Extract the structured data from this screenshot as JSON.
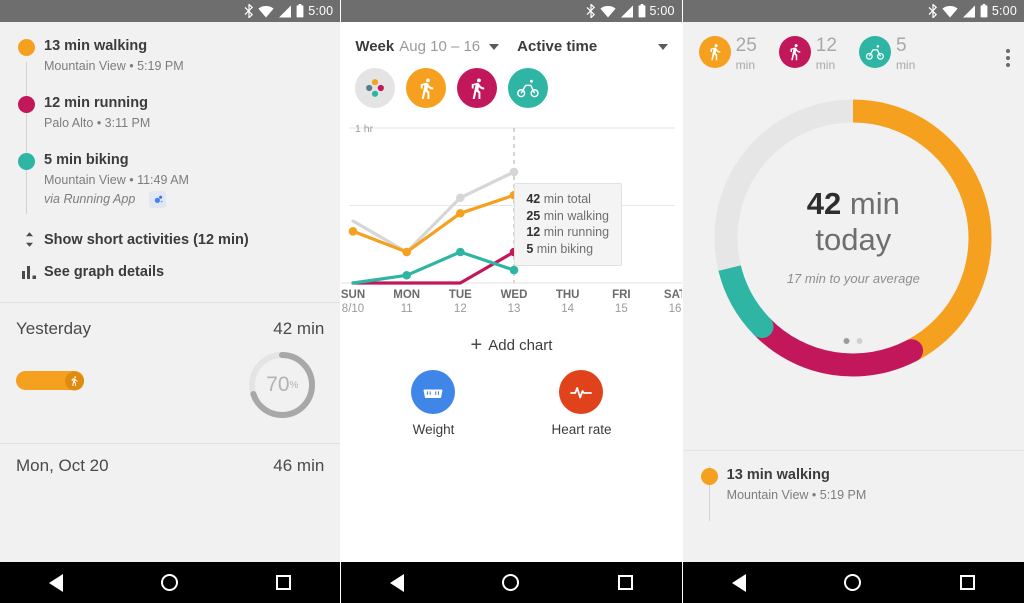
{
  "status_bar": {
    "time": "5:00",
    "icons": [
      "bluetooth-icon",
      "wifi-icon",
      "signal-icon",
      "battery-icon"
    ]
  },
  "nav_bar": {
    "back": "back-icon",
    "home": "home-icon",
    "recents": "recents-icon"
  },
  "colors": {
    "walking": "#F5A01F",
    "running": "#C2185B",
    "biking": "#2EB5A4",
    "total": "#D6D6D6",
    "weight": "#3F86E8",
    "heart_rate": "#E0431B",
    "track_empty": "#E6E6E6"
  },
  "panel1": {
    "timeline": [
      {
        "title": "13 min walking",
        "subtitle": "Mountain View • 5:19 PM",
        "color_key": "walking"
      },
      {
        "title": "12 min running",
        "subtitle": "Palo Alto • 3:11 PM",
        "color_key": "running"
      },
      {
        "title": "5 min biking",
        "subtitle": "Mountain View • 11:49 AM",
        "via": "via Running App",
        "color_key": "biking"
      }
    ],
    "actions": [
      {
        "label": "Show short activities (12 min)",
        "icon": "expand-collapse-icon"
      },
      {
        "label": "See graph details",
        "icon": "bar-chart-icon"
      }
    ],
    "day_card": {
      "day": "Yesterday",
      "total": "42 min",
      "goal_percent": "70",
      "goal_percent_symbol": "%",
      "goal_value": 70,
      "bar_icon": "walking-icon"
    },
    "next_day": {
      "day": "Mon, Oct 20",
      "total": "46 min"
    }
  },
  "panel2": {
    "header": {
      "period_label": "Week",
      "period_range": "Aug 10 – 16",
      "metric": "Active time",
      "period_caret": "chevron-down-icon",
      "metric_caret": "chevron-down-icon"
    },
    "chips": [
      {
        "name": "all-activities-chip",
        "icon": "multi-dots-icon"
      },
      {
        "name": "walking-chip",
        "icon": "walking-icon",
        "color_key": "walking"
      },
      {
        "name": "running-chip",
        "icon": "running-icon",
        "color_key": "running"
      },
      {
        "name": "biking-chip",
        "icon": "biking-icon",
        "color_key": "biking"
      }
    ],
    "tooltip": [
      {
        "value": "42",
        "text": " min total"
      },
      {
        "value": "25",
        "text": " min walking"
      },
      {
        "value": "12",
        "text": " min running"
      },
      {
        "value": "5",
        "text": " min biking"
      }
    ],
    "add_chart": {
      "label": "Add chart",
      "icon": "plus-icon"
    },
    "shortcuts": [
      {
        "label": "Weight",
        "icon": "scale-icon",
        "color_key": "weight"
      },
      {
        "label": "Heart rate",
        "icon": "heart-rate-icon",
        "color_key": "heart_rate"
      }
    ]
  },
  "chart_data": {
    "type": "line",
    "title": "Active time",
    "subtitle": "Week Aug 10 – 16",
    "xlabel": "",
    "ylabel": "",
    "grid": true,
    "legend_position": "chips-above",
    "categories": [
      "SUN",
      "MON",
      "TUE",
      "WED",
      "THU",
      "FRI",
      "SAT"
    ],
    "tick_sublabels": [
      "8/10",
      "11",
      "12",
      "13",
      "14",
      "15",
      "16"
    ],
    "ylim": [
      0,
      60
    ],
    "yticks": [
      60
    ],
    "ytick_labels": [
      "1 hr"
    ],
    "highlight_index": 3,
    "series": [
      {
        "name": "Total",
        "color": "#D6D6D6",
        "values": [
          24,
          12,
          33,
          43,
          null,
          null,
          null
        ]
      },
      {
        "name": "Walking",
        "color": "#F5A01F",
        "values": [
          20,
          12,
          27,
          34,
          null,
          null,
          null
        ]
      },
      {
        "name": "Running",
        "color": "#C2185B",
        "values": [
          0,
          0,
          0,
          12,
          null,
          null,
          null
        ]
      },
      {
        "name": "Biking",
        "color": "#2EB5A4",
        "values": [
          0,
          3,
          12,
          5,
          null,
          null,
          null
        ]
      }
    ],
    "annotation": {
      "at_category": "WED",
      "lines": [
        "42 min total",
        "25 min walking",
        "12 min running",
        "5 min biking"
      ]
    }
  },
  "panel3": {
    "summary": [
      {
        "value": "25",
        "unit": "min",
        "icon": "walking-icon",
        "color_key": "walking"
      },
      {
        "value": "12",
        "unit": "min",
        "icon": "running-icon",
        "color_key": "running"
      },
      {
        "value": "5",
        "unit": "min",
        "icon": "biking-icon",
        "color_key": "biking"
      }
    ],
    "overflow_icon": "kebab-menu-icon",
    "donut": {
      "value": "42",
      "unit": " min",
      "line2": "today",
      "caption": "17 min to your average",
      "segments": [
        {
          "name": "walking",
          "color": "#F5A01F",
          "minutes": 25
        },
        {
          "name": "running",
          "color": "#C2185B",
          "minutes": 12
        },
        {
          "name": "biking",
          "color": "#2EB5A4",
          "minutes": 5
        },
        {
          "name": "remaining",
          "color": "#E6E6E6",
          "minutes": 17
        }
      ],
      "page_dots": 2,
      "active_dot": 0
    },
    "activity": {
      "title": "13 min walking",
      "subtitle": "Mountain View • 5:19 PM",
      "color_key": "walking"
    }
  }
}
